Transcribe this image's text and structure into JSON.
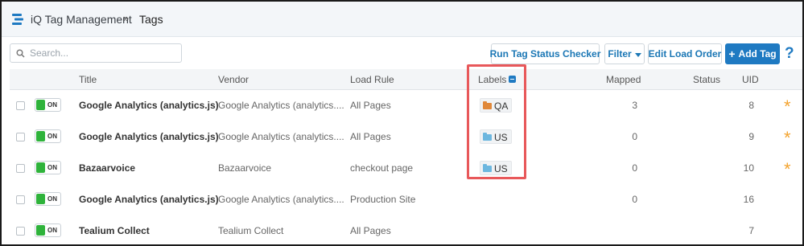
{
  "breadcrumb": {
    "root": "iQ Tag Management",
    "separator": "»",
    "current": "Tags"
  },
  "toolbar": {
    "search_placeholder": "Search...",
    "status_checker_label": "Run Tag Status Checker",
    "filter_label": "Filter",
    "edit_load_order_label": "Edit Load Order",
    "add_tag_label": "Add Tag",
    "add_tag_plus": "+",
    "help_label": "?"
  },
  "colors": {
    "accent": "#1f7ac2",
    "on_toggle": "#2fb33b",
    "star": "#f3a32e",
    "label_qa": "#e0883a",
    "label_us": "#6db7df",
    "highlight": "#e8585a"
  },
  "table": {
    "columns": {
      "title": "Title",
      "vendor": "Vendor",
      "load_rule": "Load Rule",
      "labels": "Labels",
      "mapped": "Mapped",
      "status": "Status",
      "uid": "UID"
    },
    "rows": [
      {
        "state": "ON",
        "title": "Google Analytics (analytics.js)",
        "vendor": "Google Analytics (analytics....",
        "load_rule": "All Pages",
        "label": "QA",
        "label_icon": "folder-orange-icon",
        "mapped": "3",
        "status": "",
        "uid": "8",
        "starred": true
      },
      {
        "state": "ON",
        "title": "Google Analytics (analytics.js)",
        "vendor": "Google Analytics (analytics....",
        "load_rule": "All Pages",
        "label": "US",
        "label_icon": "folder-blue-icon",
        "mapped": "0",
        "status": "",
        "uid": "9",
        "starred": true
      },
      {
        "state": "ON",
        "title": "Bazaarvoice",
        "vendor": "Bazaarvoice",
        "load_rule": "checkout page",
        "label": "US",
        "label_icon": "folder-blue-icon",
        "mapped": "0",
        "status": "",
        "uid": "10",
        "starred": true
      },
      {
        "state": "ON",
        "title": "Google Analytics (analytics.js)",
        "vendor": "Google Analytics (analytics....",
        "load_rule": "Production Site",
        "label": "",
        "label_icon": "",
        "mapped": "0",
        "status": "",
        "uid": "16",
        "starred": false
      },
      {
        "state": "ON",
        "title": "Tealium Collect",
        "vendor": "Tealium Collect",
        "load_rule": "All Pages",
        "label": "",
        "label_icon": "",
        "mapped": "",
        "status": "",
        "uid": "7",
        "starred": false
      }
    ]
  }
}
